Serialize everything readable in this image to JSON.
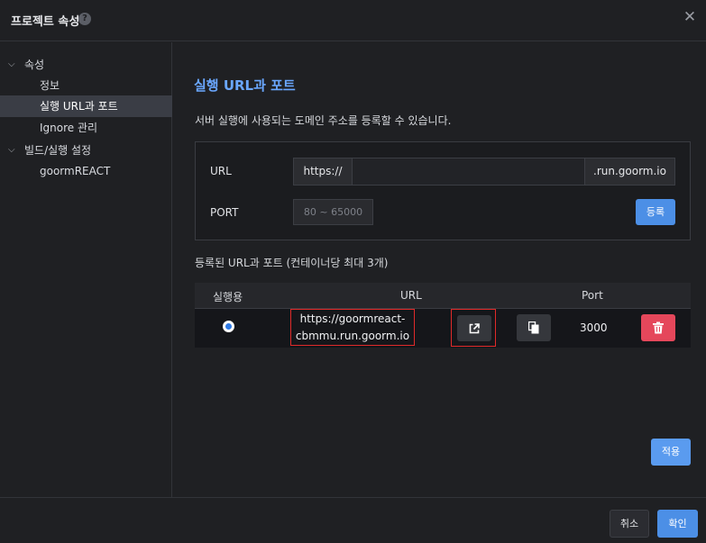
{
  "dialog": {
    "title": "프로젝트 속성",
    "help_icon": "question-circle-icon",
    "close_icon": "close-icon",
    "close_glyph": "✕"
  },
  "sidebar": {
    "groups": [
      {
        "label": "속성",
        "expanded": true,
        "chevron": "⌵",
        "items": [
          {
            "label": "정보",
            "active": false
          },
          {
            "label": "실행 URL과 포트",
            "active": true
          },
          {
            "label": "Ignore 관리",
            "active": false
          }
        ]
      },
      {
        "label": "빌드/실행 설정",
        "expanded": true,
        "chevron": "⌵",
        "items": [
          {
            "label": "goormREACT",
            "active": false
          }
        ]
      }
    ]
  },
  "main": {
    "section_title": "실행 URL과 포트",
    "description": "서버 실행에 사용되는 도메인 주소를 등록할 수 있습니다.",
    "form": {
      "url_label": "URL",
      "url_prefix": "https://",
      "url_value": "",
      "url_suffix": ".run.goorm.io",
      "port_label": "PORT",
      "port_placeholder": "80 ~ 65000",
      "port_value": "",
      "register_label": "등록"
    },
    "list_title": "등록된 URL과 포트 (컨테이너당 최대 3개)",
    "table": {
      "headers": [
        "실행용",
        "URL",
        "Port"
      ],
      "rows": [
        {
          "selected": true,
          "url_line1": "https://goormreact-",
          "url_line2": "cbmmu.run.goorm.io",
          "port": "3000",
          "open_icon": "external-link-icon",
          "copy_icon": "copy-icon",
          "delete_icon": "trash-icon"
        }
      ]
    },
    "apply_label": "적용"
  },
  "footer": {
    "cancel_label": "취소",
    "ok_label": "확인"
  },
  "colors": {
    "accent": "#4c8fe6",
    "title_blue": "#6aa7ff",
    "danger": "#e5475b",
    "highlight_border": "#e02a2a"
  }
}
